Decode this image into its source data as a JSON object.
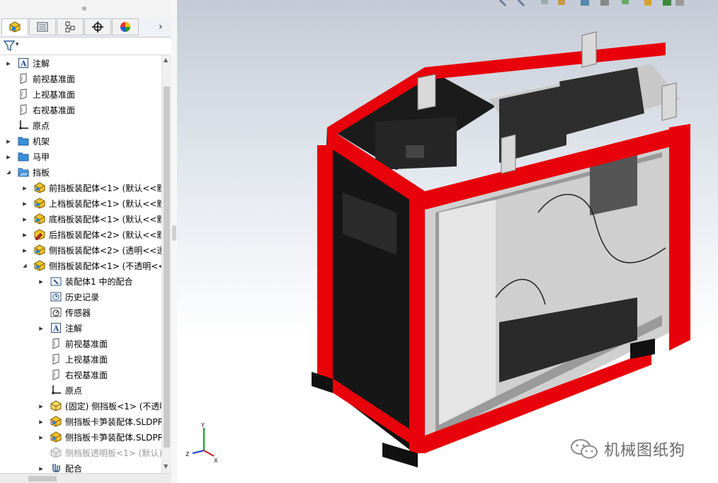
{
  "feature_manager": {
    "tabs": [
      {
        "name": "featuremanager-tab",
        "icon": "assembly-icon",
        "active": true
      },
      {
        "name": "propertymanager-tab",
        "icon": "property-list-icon",
        "active": false
      },
      {
        "name": "configurationmanager-tab",
        "icon": "configuration-icon",
        "active": false
      },
      {
        "name": "dimxpert-tab",
        "icon": "crosshair-icon",
        "active": false
      },
      {
        "name": "display-manager-tab",
        "icon": "color-wheel-icon",
        "active": false
      }
    ],
    "more_tabs_glyph": "›",
    "filter_glyph": "▾"
  },
  "tree": [
    {
      "label": "注解",
      "icon": "annotation-icon",
      "level": 0,
      "expander": "right"
    },
    {
      "label": "前视基准面",
      "icon": "plane-icon",
      "level": 0,
      "expander": "none"
    },
    {
      "label": "上视基准面",
      "icon": "plane-icon",
      "level": 0,
      "expander": "none"
    },
    {
      "label": "右视基准面",
      "icon": "plane-icon",
      "level": 0,
      "expander": "none"
    },
    {
      "label": "原点",
      "icon": "origin-icon",
      "level": 0,
      "expander": "none"
    },
    {
      "label": "机架",
      "icon": "folder-icon",
      "level": 0,
      "expander": "right"
    },
    {
      "label": "马甲",
      "icon": "folder-icon",
      "level": 0,
      "expander": "right"
    },
    {
      "label": "挡板",
      "icon": "folder-open-icon",
      "level": 0,
      "expander": "down"
    },
    {
      "label": "前挡板装配体<1> (默认<<默",
      "icon": "subassembly-icon",
      "level": 1,
      "expander": "right"
    },
    {
      "label": "上档板装配体<1> (默认<<默",
      "icon": "subassembly-icon",
      "level": 1,
      "expander": "right"
    },
    {
      "label": "底档板装配体<1> (默认<<默",
      "icon": "subassembly-icon",
      "level": 1,
      "expander": "right"
    },
    {
      "label": "后挡板装配体<2> (默认<<默",
      "icon": "subassembly-edit-icon",
      "level": 1,
      "expander": "right"
    },
    {
      "label": "侧挡板装配体<2> (透明<<透",
      "icon": "subassembly-icon",
      "level": 1,
      "expander": "right"
    },
    {
      "label": "侧挡板装配体<1> (不透明<<",
      "icon": "subassembly-icon",
      "level": 1,
      "expander": "down"
    },
    {
      "label": "装配体1 中的配合",
      "icon": "mates-folder-icon",
      "level": 2,
      "expander": "right"
    },
    {
      "label": "历史记录",
      "icon": "history-icon",
      "level": 2,
      "expander": "none"
    },
    {
      "label": "传感器",
      "icon": "sensor-icon",
      "level": 2,
      "expander": "none"
    },
    {
      "label": "注解",
      "icon": "annotation-icon",
      "level": 2,
      "expander": "right"
    },
    {
      "label": "前视基准面",
      "icon": "plane-icon",
      "level": 2,
      "expander": "none"
    },
    {
      "label": "上视基准面",
      "icon": "plane-icon",
      "level": 2,
      "expander": "none"
    },
    {
      "label": "右视基准面",
      "icon": "plane-icon",
      "level": 2,
      "expander": "none"
    },
    {
      "label": "原点",
      "icon": "origin-icon",
      "level": 2,
      "expander": "none"
    },
    {
      "label": "(固定) 侧挡板<1> (不透明",
      "icon": "part-icon",
      "level": 2,
      "expander": "right"
    },
    {
      "label": "侧挡板卡笋装配体.SLDPR",
      "icon": "subassembly-icon",
      "level": 2,
      "expander": "right"
    },
    {
      "label": "侧挡板卡笋装配体.SLDPR",
      "icon": "subassembly-icon",
      "level": 2,
      "expander": "right"
    },
    {
      "label": "侧档板透明板<1> (默认)",
      "icon": "suppressed-part-icon",
      "level": 2,
      "expander": "none",
      "grayed": true
    },
    {
      "label": "配合",
      "icon": "mates-icon",
      "level": 2,
      "expander": "right"
    }
  ],
  "viewport": {
    "triad_labels": {
      "x": "X",
      "y": "Y",
      "z": "Z"
    }
  },
  "watermark": {
    "text": "机械图纸狗",
    "icon": "wechat-icon"
  },
  "colors": {
    "frame_red": "#e8000a",
    "panel_black": "#141414",
    "panel_gray": "#c8c8c8",
    "background_top": "#c4cbd6"
  }
}
